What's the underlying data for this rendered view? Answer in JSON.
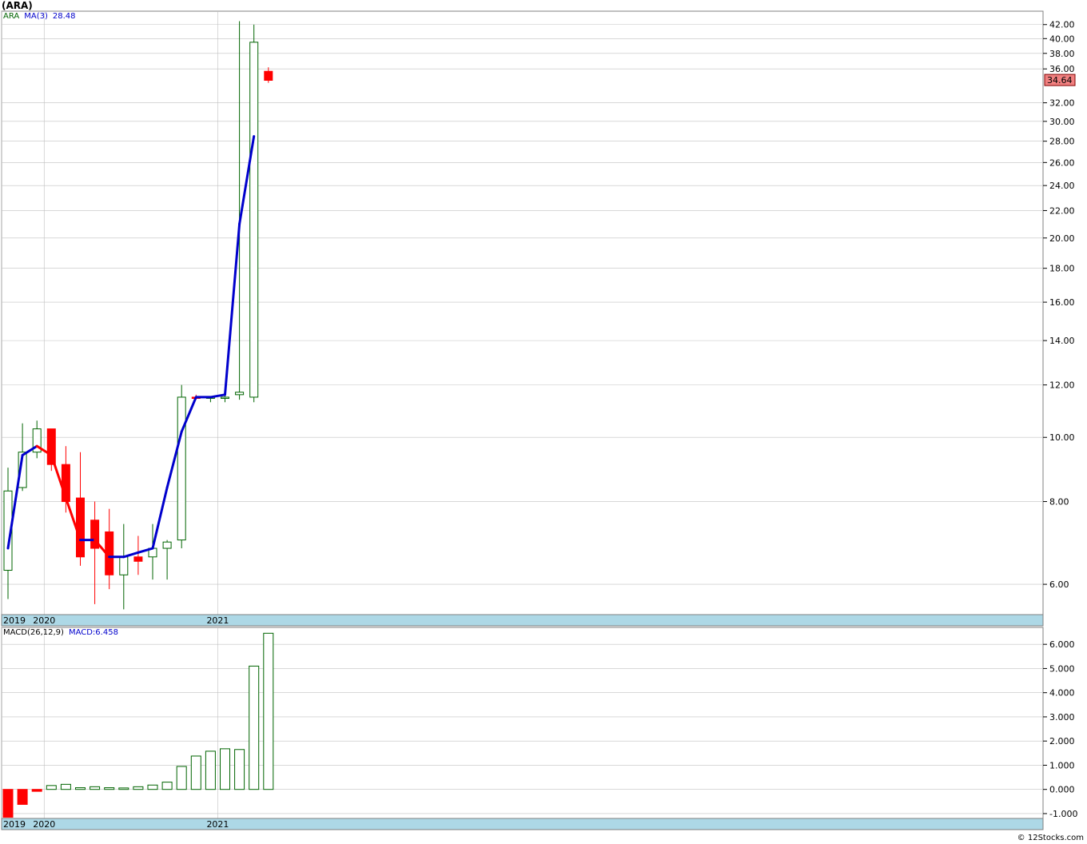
{
  "title": "(ARA)",
  "price_legend": {
    "symbol": "ARA",
    "ma_label": "MA(3)",
    "ma_value": "28.48"
  },
  "macd_legend": {
    "label": "MACD(26,12,9)",
    "value_label": "MACD:6.458"
  },
  "last_price_badge": "34.64",
  "footer": "© 12Stocks.com",
  "colors": {
    "up": "#006400",
    "down": "#ff0000",
    "ma_up": "#0000cc",
    "ma_down": "#ff0000",
    "axis_band": "#add8e6",
    "grid": "#c0c0c0"
  },
  "chart_data": [
    {
      "type": "candlestick",
      "scale": "log",
      "y_tick_labels": [
        "6.00",
        "8.00",
        "10.00",
        "12.00",
        "14.00",
        "16.00",
        "18.00",
        "20.00",
        "22.00",
        "24.00",
        "26.00",
        "28.00",
        "30.00",
        "32.00",
        "36.00",
        "38.00",
        "40.00",
        "42.00"
      ],
      "y_ticks": [
        6,
        8,
        10,
        12,
        14,
        16,
        18,
        20,
        22,
        24,
        26,
        28,
        30,
        32,
        36,
        38,
        40,
        42
      ],
      "ylim": [
        5.4,
        44
      ],
      "x_labels": [
        "2019",
        "2020",
        "2021"
      ],
      "x_label_index": [
        0,
        3,
        15
      ],
      "candles": [
        {
          "o": 6.3,
          "h": 9.0,
          "l": 5.7,
          "c": 8.3
        },
        {
          "o": 8.4,
          "h": 10.5,
          "l": 8.3,
          "c": 9.5
        },
        {
          "o": 9.5,
          "h": 10.6,
          "l": 9.3,
          "c": 10.3
        },
        {
          "o": 10.3,
          "h": 10.3,
          "l": 8.9,
          "c": 9.1
        },
        {
          "o": 9.1,
          "h": 9.7,
          "l": 7.7,
          "c": 8.0
        },
        {
          "o": 8.1,
          "h": 9.5,
          "l": 6.4,
          "c": 6.6
        },
        {
          "o": 7.5,
          "h": 8.0,
          "l": 5.6,
          "c": 6.8
        },
        {
          "o": 7.2,
          "h": 7.8,
          "l": 5.9,
          "c": 6.2
        },
        {
          "o": 6.2,
          "h": 7.4,
          "l": 5.5,
          "c": 6.6
        },
        {
          "o": 6.6,
          "h": 7.1,
          "l": 6.2,
          "c": 6.5
        },
        {
          "o": 6.6,
          "h": 7.4,
          "l": 6.1,
          "c": 6.8
        },
        {
          "o": 6.8,
          "h": 7.0,
          "l": 6.1,
          "c": 6.95
        },
        {
          "o": 7.0,
          "h": 12.0,
          "l": 6.8,
          "c": 11.5
        },
        {
          "o": 11.5,
          "h": 11.6,
          "l": 11.4,
          "c": 11.45
        },
        {
          "o": 11.5,
          "h": 11.5,
          "l": 11.3,
          "c": 11.5
        },
        {
          "o": 11.5,
          "h": 11.6,
          "l": 11.3,
          "c": 11.5
        },
        {
          "o": 11.6,
          "h": 42.5,
          "l": 11.4,
          "c": 11.7
        },
        {
          "o": 11.5,
          "h": 42.0,
          "l": 11.3,
          "c": 39.5
        },
        {
          "o": 35.7,
          "h": 36.2,
          "l": 34.3,
          "c": 34.6
        }
      ],
      "ma3": [
        6.8,
        9.4,
        9.7,
        9.4,
        8.1,
        7.0,
        7.0,
        6.6,
        6.6,
        6.7,
        6.8,
        8.4,
        10.2,
        11.5,
        11.5,
        11.6,
        21.0,
        28.48
      ],
      "ma3_start_index": 0
    },
    {
      "type": "bar",
      "title": "MACD(26,12,9)",
      "y_tick_labels": [
        "-1.000",
        "0.000",
        "1.000",
        "2.000",
        "3.000",
        "4.000",
        "5.000",
        "6.000"
      ],
      "y_ticks": [
        -1,
        0,
        1,
        2,
        3,
        4,
        5,
        6
      ],
      "ylim": [
        -1.2,
        6.7
      ],
      "values": [
        -1.15,
        -0.62,
        -0.08,
        0.16,
        0.21,
        0.07,
        0.11,
        0.07,
        0.06,
        0.11,
        0.18,
        0.3,
        0.95,
        1.38,
        1.58,
        1.68,
        1.65,
        5.1,
        6.458
      ]
    }
  ]
}
